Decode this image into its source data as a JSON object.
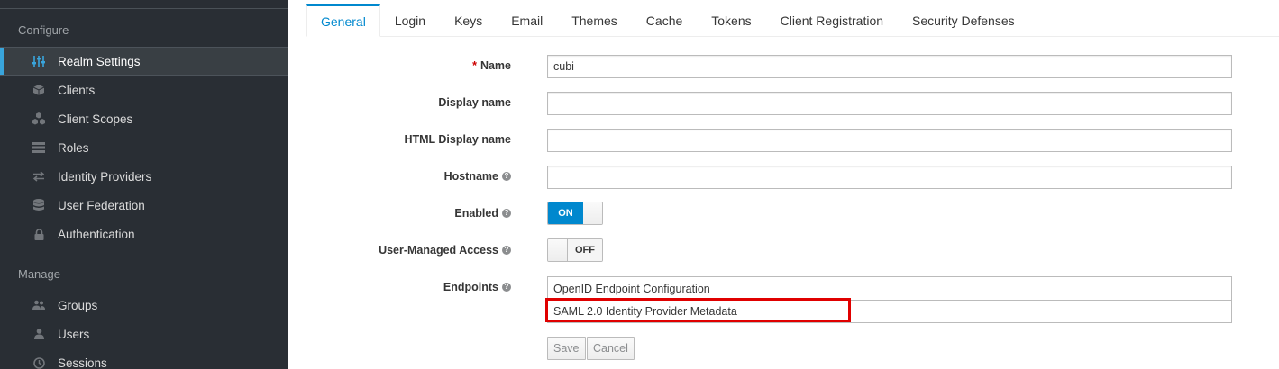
{
  "sidebar": {
    "configure_heading": "Configure",
    "manage_heading": "Manage",
    "configure_items": [
      {
        "label": "Realm Settings",
        "icon": "sliders-icon",
        "active": true
      },
      {
        "label": "Clients",
        "icon": "cube-icon"
      },
      {
        "label": "Client Scopes",
        "icon": "cubes-icon"
      },
      {
        "label": "Roles",
        "icon": "list-icon"
      },
      {
        "label": "Identity Providers",
        "icon": "exchange-icon"
      },
      {
        "label": "User Federation",
        "icon": "database-icon"
      },
      {
        "label": "Authentication",
        "icon": "lock-icon"
      }
    ],
    "manage_items": [
      {
        "label": "Groups",
        "icon": "users-icon"
      },
      {
        "label": "Users",
        "icon": "user-icon"
      },
      {
        "label": "Sessions",
        "icon": "clock-icon"
      }
    ]
  },
  "tabs": [
    "General",
    "Login",
    "Keys",
    "Email",
    "Themes",
    "Cache",
    "Tokens",
    "Client Registration",
    "Security Defenses"
  ],
  "active_tab": "General",
  "form": {
    "name_label": "Name",
    "name_required_marker": "*",
    "name_value": "cubi",
    "display_name_label": "Display name",
    "display_name_value": "",
    "html_display_name_label": "HTML Display name",
    "html_display_name_value": "",
    "hostname_label": "Hostname",
    "hostname_value": "",
    "enabled_label": "Enabled",
    "enabled_state": "ON",
    "uma_label": "User-Managed Access",
    "uma_state": "OFF",
    "endpoints_label": "Endpoints",
    "endpoints": [
      "OpenID Endpoint Configuration",
      "SAML 2.0 Identity Provider Metadata"
    ],
    "help_glyph": "?"
  },
  "buttons": {
    "save": "Save",
    "cancel": "Cancel"
  },
  "colors": {
    "sidebar_bg": "#292e34",
    "accent": "#0088ce",
    "active_bar": "#39a5dc",
    "highlight": "#e00000"
  }
}
